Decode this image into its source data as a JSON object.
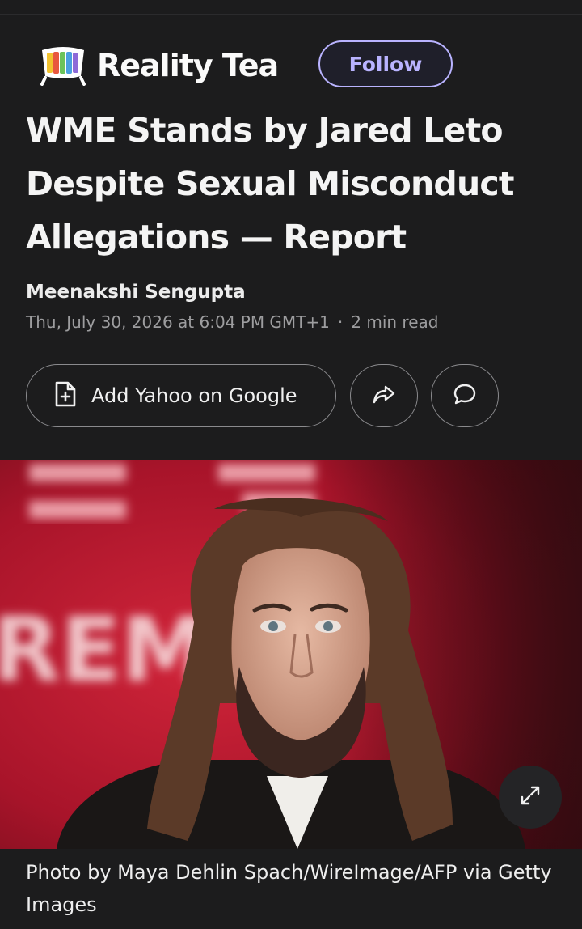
{
  "publisher": {
    "name": "Reality Tea",
    "logo_icon": "tv-stripes-icon",
    "follow_label": "Follow"
  },
  "article": {
    "headline": "WME Stands by Jared Leto Despite Sexual Misconduct Allegations — Report",
    "author": "Meenakshi Sengupta",
    "date": "Thu, July 30, 2026 at 6:04 PM GMT+1",
    "separator": "·",
    "read_time": "2 min read"
  },
  "actions": {
    "add_label": "Add Yahoo on Google",
    "add_icon": "document-plus-icon",
    "share_icon": "share-arrow-icon",
    "comment_icon": "speech-bubble-icon"
  },
  "hero": {
    "background_text": "REM",
    "expand_icon": "expand-arrows-icon"
  },
  "caption": "Photo by Maya Dehlin Spach/WireImage/AFP via Getty Images",
  "colors": {
    "background": "#1c1c1d",
    "accent": "#b9b3ff",
    "hero_red": "#b7182a"
  }
}
